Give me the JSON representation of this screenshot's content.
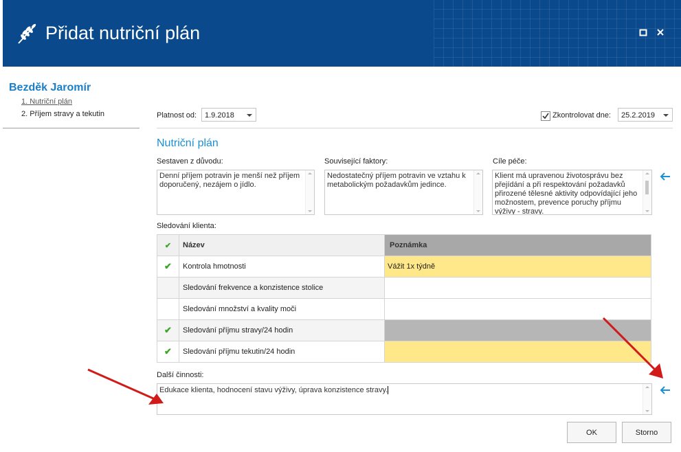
{
  "window": {
    "title": "Přidat nutriční plán",
    "logo_icon": "wheat-icon",
    "maximize_icon": "maximize-icon",
    "close_icon": "close-icon",
    "header_color": "#0a4a8c"
  },
  "sidebar": {
    "client_name": "Bezděk Jaromír",
    "items": [
      {
        "label": "1. Nutriční plán",
        "active": true
      },
      {
        "label": "2. Příjem stravy a tekutin",
        "active": false
      }
    ]
  },
  "form": {
    "valid_from_label": "Platnost od:",
    "valid_from_value": "1.9.2018",
    "check_label": "Zkontrolovat dne:",
    "check_checked": true,
    "check_value": "25.2.2019",
    "section_title": "Nutriční plán",
    "reason_label": "Sestaven z důvodu:",
    "reason_value": "Denní příjem potravin je menší než příjem doporučený, nezájem o jídlo.",
    "factors_label": "Související faktory:",
    "factors_value": "Nedostatečný příjem potravin ve vztahu k metabolickým požadavkům jedince.",
    "goals_label": "Cíle péče:",
    "goals_value": "Klient má upravenou životosprávu bez přejídání a při respektování požadavků přirozené tělesné aktivity odpovídající jeho možnostem, prevence poruchy příjmu výživy - stravy.",
    "monitoring_label": "Sledování klienta:",
    "other_label": "Další činnosti:",
    "other_value": "Edukace klienta, hodnocení stavu výživy, úprava konzistence stravy.",
    "arrow_icon": "arrow-left-icon"
  },
  "grid": {
    "check_header_icon": "check-icon",
    "col_name": "Název",
    "col_note": "Poznámka",
    "rows": [
      {
        "checked": true,
        "name": "Kontrola hmotnosti",
        "note": "Vážit 1x týdně",
        "note_bg": "yellow"
      },
      {
        "checked": false,
        "name": "Sledování frekvence a konzistence stolice",
        "note": "",
        "note_bg": "white"
      },
      {
        "checked": false,
        "name": "Sledování množství a kvality moči",
        "note": "",
        "note_bg": "white"
      },
      {
        "checked": true,
        "name": "Sledování příjmu stravy/24 hodin",
        "note": "",
        "note_bg": "gray"
      },
      {
        "checked": true,
        "name": "Sledování příjmu tekutin/24 hodin",
        "note": "",
        "note_bg": "yellow"
      }
    ]
  },
  "buttons": {
    "ok": "OK",
    "cancel": "Storno"
  },
  "colors": {
    "accent": "#1a8fd6",
    "check_green": "#3aa626",
    "note_yellow": "#ffe88a",
    "annotation_red": "#d11b1b"
  }
}
